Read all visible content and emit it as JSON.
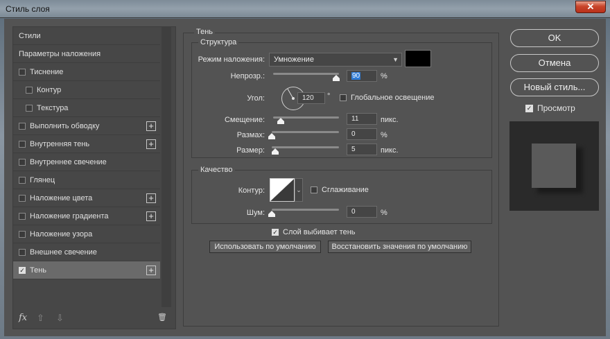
{
  "window": {
    "title": "Стиль слоя",
    "close": "✕"
  },
  "styles": {
    "items": [
      {
        "label": "Стили",
        "checkbox": false,
        "checked": false,
        "plus": false,
        "indent": false
      },
      {
        "label": "Параметры наложения",
        "checkbox": false,
        "checked": false,
        "plus": false,
        "indent": false
      },
      {
        "label": "Тиснение",
        "checkbox": true,
        "checked": false,
        "plus": false,
        "indent": false
      },
      {
        "label": "Контур",
        "checkbox": true,
        "checked": false,
        "plus": false,
        "indent": true
      },
      {
        "label": "Текстура",
        "checkbox": true,
        "checked": false,
        "plus": false,
        "indent": true
      },
      {
        "label": "Выполнить обводку",
        "checkbox": true,
        "checked": false,
        "plus": true,
        "indent": false
      },
      {
        "label": "Внутренняя тень",
        "checkbox": true,
        "checked": false,
        "plus": true,
        "indent": false
      },
      {
        "label": "Внутреннее свечение",
        "checkbox": true,
        "checked": false,
        "plus": false,
        "indent": false
      },
      {
        "label": "Глянец",
        "checkbox": true,
        "checked": false,
        "plus": false,
        "indent": false
      },
      {
        "label": "Наложение цвета",
        "checkbox": true,
        "checked": false,
        "plus": true,
        "indent": false
      },
      {
        "label": "Наложение градиента",
        "checkbox": true,
        "checked": false,
        "plus": true,
        "indent": false
      },
      {
        "label": "Наложение узора",
        "checkbox": true,
        "checked": false,
        "plus": false,
        "indent": false
      },
      {
        "label": "Внешнее свечение",
        "checkbox": true,
        "checked": false,
        "plus": false,
        "indent": false
      },
      {
        "label": "Тень",
        "checkbox": true,
        "checked": true,
        "plus": true,
        "indent": false,
        "selected": true
      }
    ],
    "footer": {
      "fx": "fx",
      "up": "⇧",
      "down": "⇩",
      "trash": "🗑"
    }
  },
  "shadow": {
    "group_title": "Тень",
    "structure": {
      "title": "Структура",
      "blend_mode_label": "Режим наложения:",
      "blend_mode_value": "Умножение",
      "opacity_label": "Непрозр.:",
      "opacity_value": "90",
      "opacity_unit": "%",
      "angle_label": "Угол:",
      "angle_value": "120",
      "angle_unit": "°",
      "global_light_label": "Глобальное освещение",
      "distance_label": "Смещение:",
      "distance_value": "11",
      "distance_unit": "пикс.",
      "spread_label": "Размах:",
      "spread_value": "0",
      "spread_unit": "%",
      "size_label": "Размер:",
      "size_value": "5",
      "size_unit": "пикс."
    },
    "quality": {
      "title": "Качество",
      "contour_label": "Контур:",
      "antialias_label": "Сглаживание",
      "noise_label": "Шум:",
      "noise_value": "0",
      "noise_unit": "%"
    },
    "knockout_label": "Слой выбивает тень",
    "make_default": "Использовать по умолчанию",
    "reset_default": "Восстановить значения по умолчанию"
  },
  "actions": {
    "ok": "OK",
    "cancel": "Отмена",
    "new_style": "Новый стиль...",
    "preview_label": "Просмотр"
  },
  "colors": {
    "shadow_color": "#000000",
    "accent": "#2e7bd6"
  }
}
